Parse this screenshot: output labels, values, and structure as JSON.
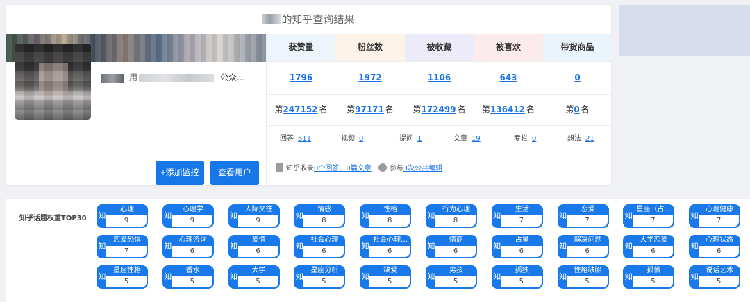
{
  "result_title_suffix": "的知乎查询结果",
  "profile": {
    "name_visible_char": "用",
    "desc_suffix": "公众…",
    "btn_monitor": "+添加监控",
    "btn_view": "查看用户"
  },
  "stats": [
    {
      "label": "获赞量",
      "value": "1796",
      "rank": "247152",
      "head_color": "#eef4fb"
    },
    {
      "label": "粉丝数",
      "value": "1972",
      "rank": "97171",
      "head_color": "#fdf3e9"
    },
    {
      "label": "被收藏",
      "value": "1106",
      "rank": "172499",
      "head_color": "#ecebfa"
    },
    {
      "label": "被喜欢",
      "value": "643",
      "rank": "136412",
      "head_color": "#fcebec"
    },
    {
      "label": "带货商品",
      "value": "0",
      "rank": "0",
      "head_color": "#eaf4fc"
    }
  ],
  "rank_prefix": "第",
  "rank_suffix": "名",
  "counts": [
    {
      "label": "回答",
      "value": "611"
    },
    {
      "label": "视频",
      "value": "0"
    },
    {
      "label": "提问",
      "value": "1"
    },
    {
      "label": "文章",
      "value": "19"
    },
    {
      "label": "专栏",
      "value": "0"
    },
    {
      "label": "想法",
      "value": "21"
    }
  ],
  "record": {
    "prefix": "知乎收录",
    "answers_link": "0个回答、",
    "articles_link": "0篇文章",
    "participate": "参与",
    "edits_link": "3次公共编辑"
  },
  "topics_label": "知乎话题权重TOP30",
  "topic_prefix": "知",
  "topics": [
    {
      "name": "心理",
      "score": "9"
    },
    {
      "name": "心理学",
      "score": "9"
    },
    {
      "name": "人际交往",
      "score": "9"
    },
    {
      "name": "情感",
      "score": "8"
    },
    {
      "name": "性格",
      "score": "8"
    },
    {
      "name": "行为心理",
      "score": "8"
    },
    {
      "name": "生活",
      "score": "7"
    },
    {
      "name": "恋爱",
      "score": "7"
    },
    {
      "name": "星座（占…",
      "score": "7"
    },
    {
      "name": "心理健康",
      "score": "7"
    },
    {
      "name": "恋爱恐惧",
      "score": "7"
    },
    {
      "name": "心理咨询",
      "score": "6"
    },
    {
      "name": "爱情",
      "score": "6"
    },
    {
      "name": "社会心理",
      "score": "6"
    },
    {
      "name": "社会心理…",
      "score": "6"
    },
    {
      "name": "情商",
      "score": "6"
    },
    {
      "name": "占星",
      "score": "6"
    },
    {
      "name": "解决问题",
      "score": "6"
    },
    {
      "name": "大学恋爱",
      "score": "6"
    },
    {
      "name": "心理状态",
      "score": "6"
    },
    {
      "name": "星座性格",
      "score": "5"
    },
    {
      "name": "香水",
      "score": "5"
    },
    {
      "name": "大学",
      "score": "5"
    },
    {
      "name": "星座分析",
      "score": "5"
    },
    {
      "name": "缺爱",
      "score": "5"
    },
    {
      "name": "男孩",
      "score": "5"
    },
    {
      "name": "孤独",
      "score": "5"
    },
    {
      "name": "性格缺陷",
      "score": "5"
    },
    {
      "name": "孤僻",
      "score": "5"
    },
    {
      "name": "说话艺术",
      "score": "5"
    }
  ]
}
